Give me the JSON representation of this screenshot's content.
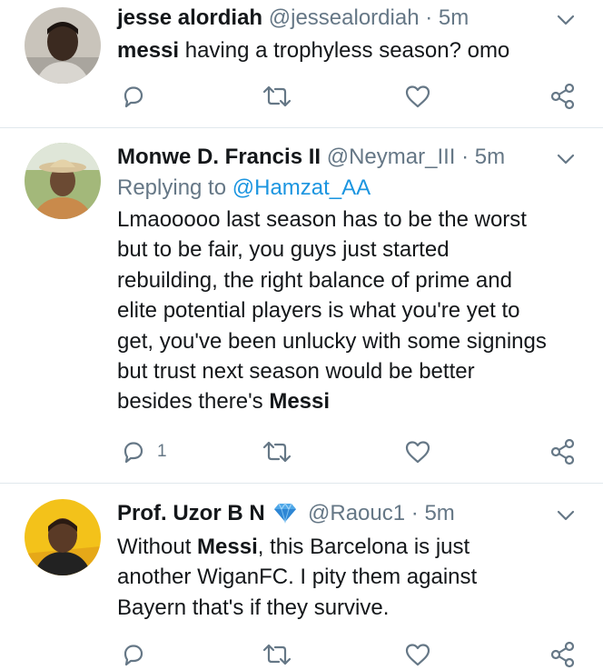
{
  "tweets": [
    {
      "name": "jesse alordiah",
      "handle": "@jessealordiah",
      "dot": "·",
      "time": "5m",
      "text_parts": [
        {
          "b": "messi"
        },
        {
          "t": " having a trophyless season? omo"
        }
      ],
      "reply_count": "",
      "avatar": "person-avatar-dark"
    },
    {
      "name": "Monwe D. Francis II",
      "handle": "@Neymar_III",
      "dot": "·",
      "time": "5m",
      "replying_label": "Replying to",
      "replying_handle": "@Hamzat_AA",
      "text_lines": [
        "Lmaooooo last season has to be the worst",
        "but to be fair, you guys just started",
        "rebuilding, the right balance of prime and",
        "elite potential players is what you're yet to",
        "get, you've been unlucky with some signings",
        "but trust next season would be better",
        "besides there's "
      ],
      "text_bold_end": "Messi",
      "reply_count": "1",
      "avatar": "person-with-hat-avatar"
    },
    {
      "name": "Prof. Uzor B N",
      "verified_icon": "diamond-emoji",
      "handle": "@Raouc1",
      "dot": "·",
      "time": "5m",
      "line1_pre": "Without ",
      "line1_bold": "Messi",
      "line1_post": ", this Barcelona is just",
      "line2": "another WiganFC. I pity them against",
      "line3": "Bayern that's if they survive.",
      "reply_count": "",
      "avatar": "person-avatar-yellow-bg"
    }
  ],
  "colors": {
    "text": "#14171a",
    "secondary": "#657786",
    "link": "#1b95e0",
    "divider": "#e1e8ed"
  }
}
